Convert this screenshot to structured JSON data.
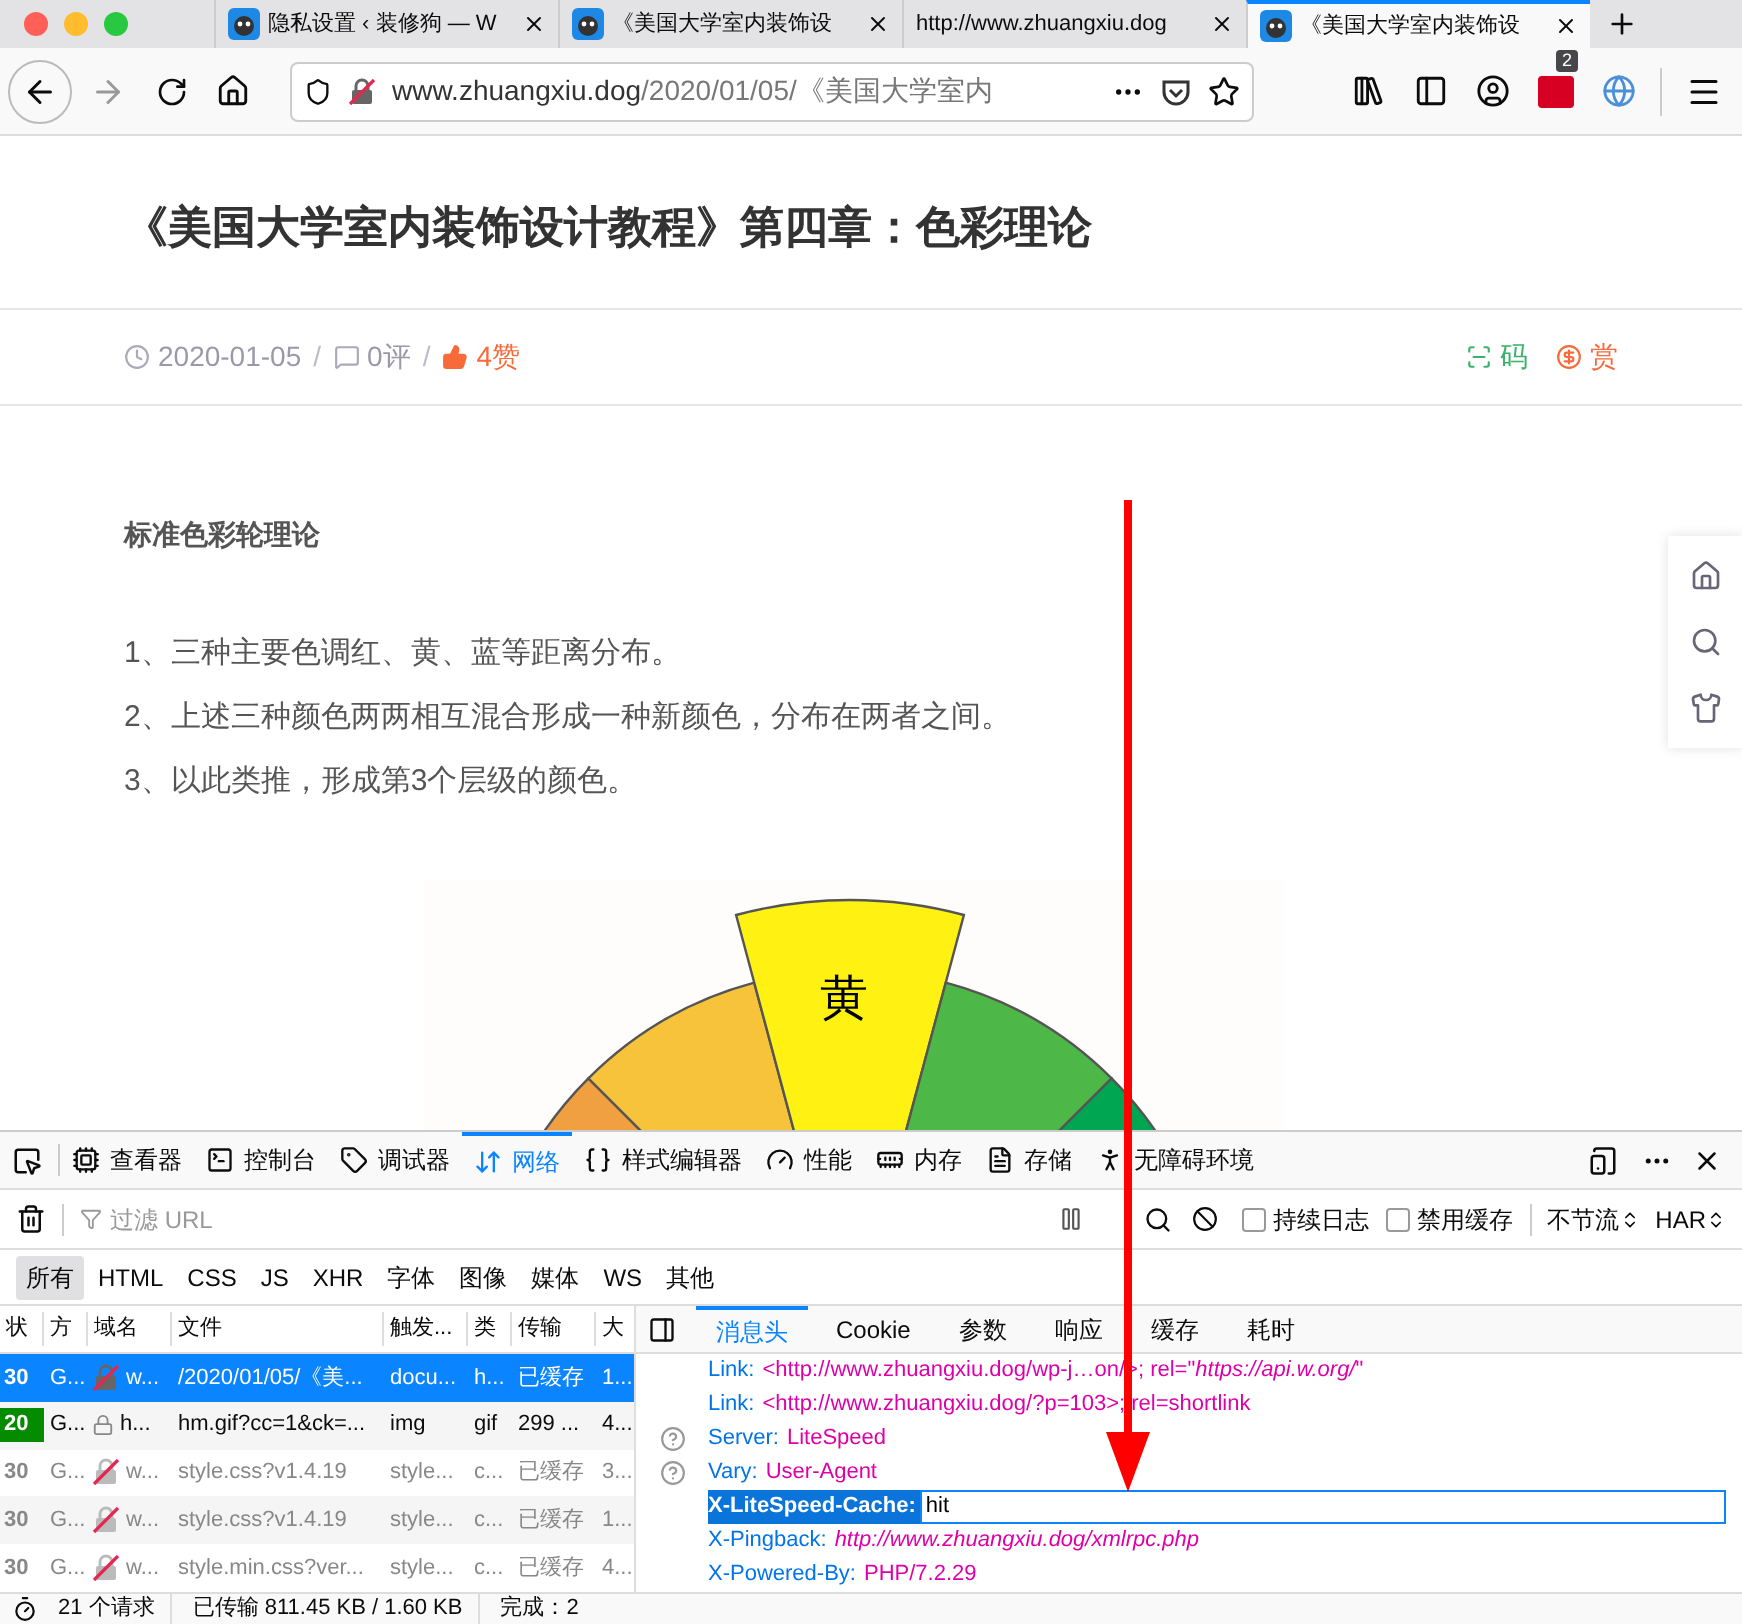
{
  "browser": {
    "tabs": [
      {
        "title": "隐私设置 ‹ 装修狗 — W",
        "has_icon": true,
        "selected": false
      },
      {
        "title": "《美国大学室内装饰设",
        "has_icon": true,
        "selected": false
      },
      {
        "title": "http://www.zhuangxiu.dog",
        "has_icon": false,
        "selected": false
      },
      {
        "title": "《美国大学室内装饰设",
        "has_icon": true,
        "selected": true
      }
    ],
    "url": {
      "domain": "www.zhuangxiu.dog",
      "path": "/2020/01/05/《美国大学室内"
    },
    "extension_badge": "2"
  },
  "article": {
    "title": "《美国大学室内装饰设计教程》第四章：色彩理论",
    "meta": {
      "date": "2020-01-05",
      "sep1": "/",
      "comments": "0评",
      "sep2": "/",
      "likes": "4赞",
      "qr": "码",
      "reward": "赏"
    },
    "heading": "标准色彩轮理论",
    "paragraphs": [
      "1、三种主要色调红、黄、蓝等距离分布。",
      "2、上述三种颜色两两相互混合形成一种新颜色，分布在两者之间。",
      "3、以此类推，形成第3个层级的颜色。"
    ],
    "figure_label": "黄"
  },
  "devtools": {
    "tabs": [
      {
        "label": "查看器",
        "selected": false
      },
      {
        "label": "控制台",
        "selected": false
      },
      {
        "label": "调试器",
        "selected": false
      },
      {
        "label": "网络",
        "selected": true
      },
      {
        "label": "样式编辑器",
        "selected": false
      },
      {
        "label": "性能",
        "selected": false
      },
      {
        "label": "内存",
        "selected": false
      },
      {
        "label": "存储",
        "selected": false
      },
      {
        "label": "无障碍环境",
        "selected": false
      }
    ],
    "filter": {
      "placeholder": "过滤 URL"
    },
    "checkboxes": [
      {
        "label": "持续日志",
        "checked": false
      },
      {
        "label": "禁用缓存",
        "checked": false
      }
    ],
    "throttle": "不节流",
    "har": "HAR",
    "type_filters": [
      {
        "label": "所有",
        "selected": true
      },
      {
        "label": "HTML",
        "selected": false
      },
      {
        "label": "CSS",
        "selected": false
      },
      {
        "label": "JS",
        "selected": false
      },
      {
        "label": "XHR",
        "selected": false
      },
      {
        "label": "字体",
        "selected": false
      },
      {
        "label": "图像",
        "selected": false
      },
      {
        "label": "媒体",
        "selected": false
      },
      {
        "label": "WS",
        "selected": false
      },
      {
        "label": "其他",
        "selected": false
      }
    ],
    "columns": [
      "状",
      "方",
      "域名",
      "文件",
      "触发...",
      "类",
      "传输",
      "大"
    ],
    "requests": [
      {
        "status": "30",
        "status_ok": false,
        "method": "G...",
        "secure": false,
        "domain": "w...",
        "file": "/2020/01/05/《美...",
        "cause": "docu...",
        "type": "h...",
        "transferred": "已缓存",
        "size": "1...",
        "cached": false,
        "selected": true
      },
      {
        "status": "20",
        "status_ok": true,
        "method": "G...",
        "secure": true,
        "domain": "h...",
        "file": "hm.gif?cc=1&ck=...",
        "cause": "img",
        "type": "gif",
        "transferred": "299 ...",
        "size": "4...",
        "cached": false,
        "selected": false
      },
      {
        "status": "30",
        "status_ok": false,
        "method": "G...",
        "secure": false,
        "domain": "w...",
        "file": "style.css?v1.4.19",
        "cause": "style...",
        "type": "c...",
        "transferred": "已缓存",
        "size": "3...",
        "cached": true,
        "selected": false
      },
      {
        "status": "30",
        "status_ok": false,
        "method": "G...",
        "secure": false,
        "domain": "w...",
        "file": "style.css?v1.4.19",
        "cause": "style...",
        "type": "c...",
        "transferred": "已缓存",
        "size": "1...",
        "cached": true,
        "selected": false
      },
      {
        "status": "30",
        "status_ok": false,
        "method": "G...",
        "secure": false,
        "domain": "w...",
        "file": "style.min.css?ver...",
        "cause": "style...",
        "type": "c...",
        "transferred": "已缓存",
        "size": "4...",
        "cached": true,
        "selected": false
      }
    ],
    "detail_tabs": [
      {
        "label": "消息头",
        "selected": true
      },
      {
        "label": "Cookie",
        "selected": false
      },
      {
        "label": "参数",
        "selected": false
      },
      {
        "label": "响应",
        "selected": false
      },
      {
        "label": "缓存",
        "selected": false
      },
      {
        "label": "耗时",
        "selected": false
      }
    ],
    "headers": [
      {
        "name": "Link:",
        "value": "<http://www.zhuangxiu.dog/wp-j…on/>; rel=\"*https://api.w.org/*\"",
        "help": false,
        "italic": false,
        "selected": false
      },
      {
        "name": "Link:",
        "value": "<http://www.zhuangxiu.dog/?p=103>; rel=shortlink",
        "help": false,
        "italic": false,
        "selected": false
      },
      {
        "name": "Server:",
        "value": "LiteSpeed",
        "help": true,
        "italic": false,
        "selected": false
      },
      {
        "name": "Vary:",
        "value": "User-Agent",
        "help": true,
        "italic": false,
        "selected": false
      },
      {
        "name": "X-LiteSpeed-Cache:",
        "value": "hit",
        "help": false,
        "italic": false,
        "selected": true
      },
      {
        "name": "X-Pingback:",
        "value": "http://www.zhuangxiu.dog/xmlrpc.php",
        "help": false,
        "italic": true,
        "selected": false
      },
      {
        "name": "X-Powered-By:",
        "value": "PHP/7.2.29",
        "help": false,
        "italic": false,
        "selected": false
      }
    ],
    "summary": {
      "requests": "21 个请求",
      "transferred": "已传输 811.45 KB / 1.60 KB",
      "finish": "完成：2"
    }
  }
}
